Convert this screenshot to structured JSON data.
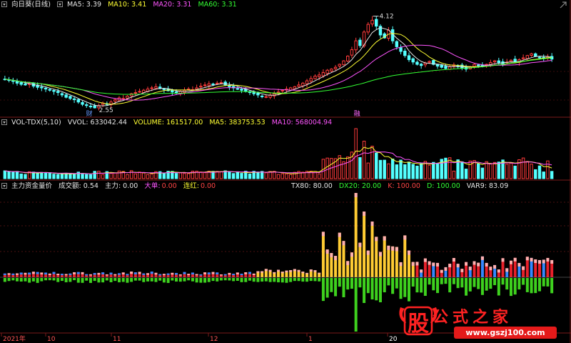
{
  "main_header": {
    "stock": "向日葵(日线)",
    "ma5": "MA5: 3.39",
    "ma10": "MA10: 3.41",
    "ma20": "MA20: 3.31",
    "ma60": "MA60: 3.31"
  },
  "vol_header": {
    "name": "VOL-TDX(5,10)",
    "vvol": "VVOL: 633042.44",
    "volume": "VOLUME: 161517.00",
    "ma5": "MA5: 383753.53",
    "ma10": "MA10: 568004.94"
  },
  "ind_header": {
    "name": "主力资金量价",
    "chengjiao": "成交额: 0.54",
    "zhuli": "主力: 0.00",
    "dadan_label": "大单:",
    "dadan_value": "0.00",
    "lianhong_label": "连红:",
    "lianhong_value": "0.00",
    "tx80": "TX80: 80.00",
    "dx20": "DX20: 20.00",
    "k": "K: 100.00",
    "d": "D: 100.00",
    "var9": "VAR9: 83.09"
  },
  "annotations": {
    "high": "4.12",
    "low": "2.55",
    "tag_cai": "财",
    "tag_rong": "融"
  },
  "x_axis_labels": [
    "2021年",
    "10",
    "11",
    "12",
    "1",
    "20"
  ],
  "watermark": {
    "badge": "股",
    "site_name": "公式之家",
    "url": "www.gszj100.com"
  },
  "colors": {
    "up": "#ff3b3b",
    "down": "#54ffff",
    "ma5": "#e6e6e6",
    "ma10": "#ffff33",
    "ma20": "#ff55ff",
    "ma60": "#33ff33",
    "grid": "#7a1a1a",
    "bar_green": "#3ed11e",
    "bar_yellow": "#ffcc33",
    "bar_pink": "#ffb0b0",
    "bar_red": "#e8202a",
    "bar_blue": "#3388ff"
  },
  "chart_data": {
    "type": "candlestick",
    "title": "向日葵(日线)",
    "price_range": [
      2.55,
      4.12
    ],
    "ylim": [
      2.45,
      4.2
    ],
    "close": [
      3.05,
      3.03,
      3.01,
      2.98,
      2.96,
      2.95,
      2.97,
      2.93,
      2.91,
      2.9,
      2.88,
      2.86,
      2.84,
      2.82,
      2.78,
      2.74,
      2.72,
      2.7,
      2.66,
      2.62,
      2.6,
      2.58,
      2.56,
      2.6,
      2.64,
      2.62,
      2.66,
      2.7,
      2.73,
      2.72,
      2.76,
      2.8,
      2.82,
      2.84,
      2.86,
      2.88,
      2.9,
      2.92,
      2.89,
      2.87,
      2.85,
      2.83,
      2.81,
      2.84,
      2.86,
      2.88,
      2.87,
      2.9,
      2.93,
      2.95,
      2.97,
      2.96,
      2.98,
      2.99,
      2.95,
      2.92,
      2.9,
      2.88,
      2.86,
      2.84,
      2.82,
      2.8,
      2.78,
      2.76,
      2.75,
      2.78,
      2.8,
      2.83,
      2.86,
      2.88,
      2.9,
      2.92,
      2.95,
      2.98,
      3.02,
      3.06,
      3.1,
      3.12,
      3.16,
      3.2,
      3.22,
      3.25,
      3.3,
      3.36,
      3.44,
      3.55,
      3.7,
      3.62,
      3.85,
      3.98,
      4.05,
      3.95,
      3.8,
      3.75,
      3.88,
      3.7,
      3.6,
      3.52,
      3.45,
      3.38,
      3.34,
      3.3,
      3.28,
      3.32,
      3.35,
      3.3,
      3.27,
      3.25,
      3.23,
      3.26,
      3.29,
      3.27,
      3.24,
      3.22,
      3.26,
      3.3,
      3.28,
      3.27,
      3.3,
      3.33,
      3.36,
      3.33,
      3.31,
      3.34,
      3.37,
      3.35,
      3.38,
      3.41,
      3.45,
      3.48,
      3.44,
      3.42,
      3.4,
      3.43,
      3.39
    ],
    "series": [
      {
        "name": "VVOL",
        "values": [
          633042.44
        ]
      },
      {
        "name": "VOLUME",
        "values": [
          161517.0
        ]
      },
      {
        "name": "MA5",
        "values": [
          383753.53
        ]
      },
      {
        "name": "MA10",
        "values": [
          568004.94
        ]
      }
    ]
  }
}
